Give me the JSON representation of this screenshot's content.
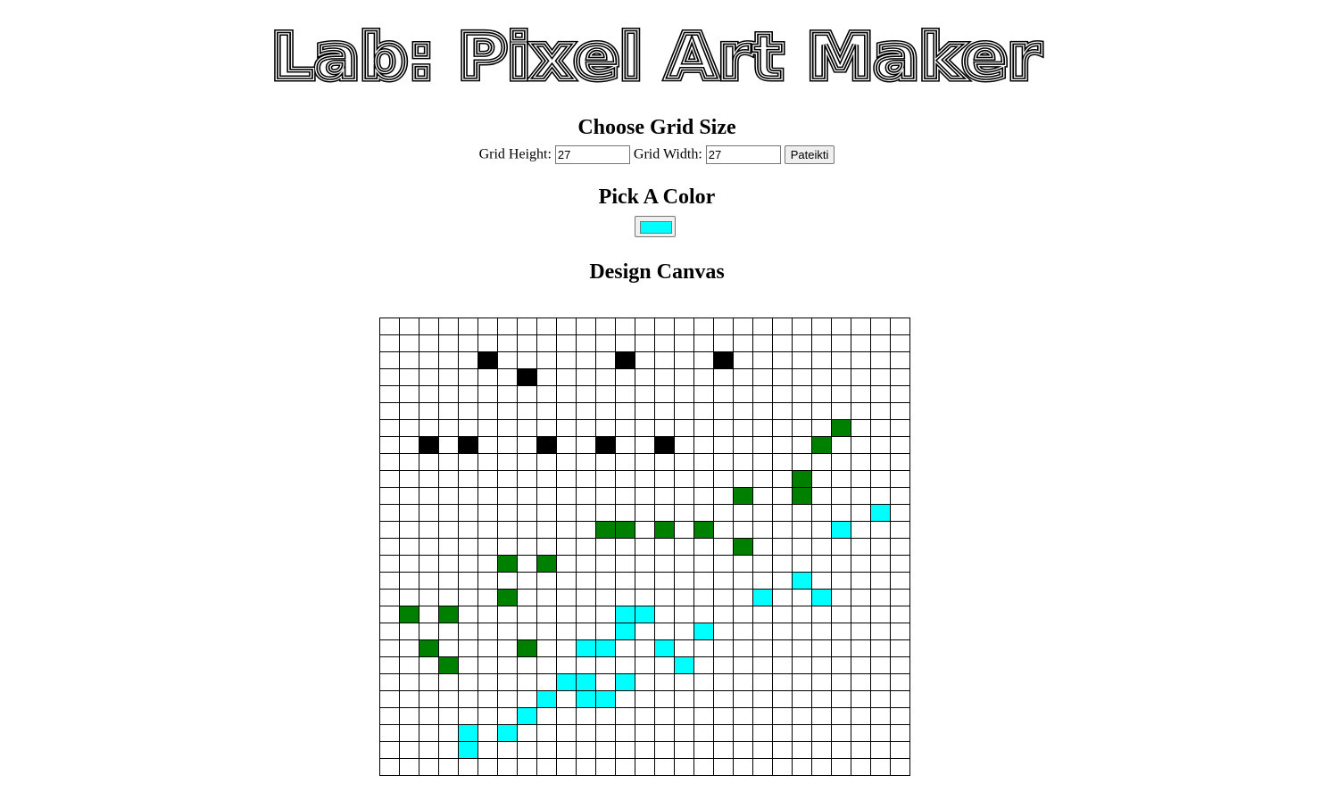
{
  "page": {
    "logo_text": "Lab: Pixel Art Maker"
  },
  "grid_size": {
    "title": "Choose Grid Size",
    "height_label": "Grid Height:",
    "height_value": "27",
    "width_label": "Grid Width:",
    "width_value": "27",
    "submit_label": "Pateikti"
  },
  "color": {
    "title": "Pick A Color",
    "value": "#00ffff"
  },
  "canvas": {
    "title": "Design Canvas",
    "rows": 27,
    "cols": 27,
    "colors": {
      "B": "#000000",
      "G": "#008000",
      "C": "#00ffff"
    },
    "painted": [
      {
        "row": 2,
        "col": 5,
        "c": "B"
      },
      {
        "row": 2,
        "col": 12,
        "c": "B"
      },
      {
        "row": 2,
        "col": 17,
        "c": "B"
      },
      {
        "row": 3,
        "col": 7,
        "c": "B"
      },
      {
        "row": 6,
        "col": 23,
        "c": "G"
      },
      {
        "row": 7,
        "col": 2,
        "c": "B"
      },
      {
        "row": 7,
        "col": 4,
        "c": "B"
      },
      {
        "row": 7,
        "col": 8,
        "c": "B"
      },
      {
        "row": 7,
        "col": 11,
        "c": "B"
      },
      {
        "row": 7,
        "col": 14,
        "c": "B"
      },
      {
        "row": 7,
        "col": 22,
        "c": "G"
      },
      {
        "row": 9,
        "col": 21,
        "c": "G"
      },
      {
        "row": 10,
        "col": 18,
        "c": "G"
      },
      {
        "row": 10,
        "col": 21,
        "c": "G"
      },
      {
        "row": 11,
        "col": 25,
        "c": "C"
      },
      {
        "row": 12,
        "col": 11,
        "c": "G"
      },
      {
        "row": 12,
        "col": 12,
        "c": "G"
      },
      {
        "row": 12,
        "col": 14,
        "c": "G"
      },
      {
        "row": 12,
        "col": 16,
        "c": "G"
      },
      {
        "row": 12,
        "col": 23,
        "c": "C"
      },
      {
        "row": 13,
        "col": 18,
        "c": "G"
      },
      {
        "row": 14,
        "col": 6,
        "c": "G"
      },
      {
        "row": 14,
        "col": 8,
        "c": "G"
      },
      {
        "row": 15,
        "col": 21,
        "c": "C"
      },
      {
        "row": 16,
        "col": 6,
        "c": "G"
      },
      {
        "row": 16,
        "col": 19,
        "c": "C"
      },
      {
        "row": 16,
        "col": 22,
        "c": "C"
      },
      {
        "row": 17,
        "col": 1,
        "c": "G"
      },
      {
        "row": 17,
        "col": 3,
        "c": "G"
      },
      {
        "row": 17,
        "col": 12,
        "c": "C"
      },
      {
        "row": 17,
        "col": 13,
        "c": "C"
      },
      {
        "row": 18,
        "col": 12,
        "c": "C"
      },
      {
        "row": 18,
        "col": 16,
        "c": "C"
      },
      {
        "row": 19,
        "col": 2,
        "c": "G"
      },
      {
        "row": 19,
        "col": 7,
        "c": "G"
      },
      {
        "row": 19,
        "col": 10,
        "c": "C"
      },
      {
        "row": 19,
        "col": 11,
        "c": "C"
      },
      {
        "row": 19,
        "col": 14,
        "c": "C"
      },
      {
        "row": 20,
        "col": 3,
        "c": "G"
      },
      {
        "row": 20,
        "col": 15,
        "c": "C"
      },
      {
        "row": 21,
        "col": 9,
        "c": "C"
      },
      {
        "row": 21,
        "col": 10,
        "c": "C"
      },
      {
        "row": 21,
        "col": 12,
        "c": "C"
      },
      {
        "row": 22,
        "col": 8,
        "c": "C"
      },
      {
        "row": 22,
        "col": 10,
        "c": "C"
      },
      {
        "row": 22,
        "col": 11,
        "c": "C"
      },
      {
        "row": 23,
        "col": 7,
        "c": "C"
      },
      {
        "row": 24,
        "col": 4,
        "c": "C"
      },
      {
        "row": 24,
        "col": 6,
        "c": "C"
      },
      {
        "row": 25,
        "col": 4,
        "c": "C"
      }
    ]
  }
}
